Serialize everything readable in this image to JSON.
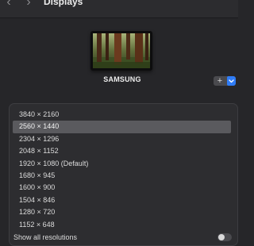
{
  "window": {
    "title": "Displays",
    "back_icon": "chevron-left-icon",
    "forward_icon": "chevron-right-icon"
  },
  "display": {
    "name": "SAMSUNG",
    "add_label": "+",
    "add_menu_icon": "chevron-down-icon"
  },
  "resolutions": {
    "items": [
      "3840 × 2160",
      "2560 × 1440",
      "2304 × 1296",
      "2048 × 1152",
      "1920 × 1080 (Default)",
      "1680 × 945",
      "1600 × 900",
      "1504 × 846",
      "1280 × 720",
      "1152 × 648"
    ],
    "selected": "2560 × 1440"
  },
  "show_all": {
    "label": "Show all resolutions",
    "enabled": false
  },
  "colors": {
    "accent": "#2f7cf6",
    "background": "#262629",
    "panel": "#2d2d30",
    "selection": "#5a5a5e"
  }
}
